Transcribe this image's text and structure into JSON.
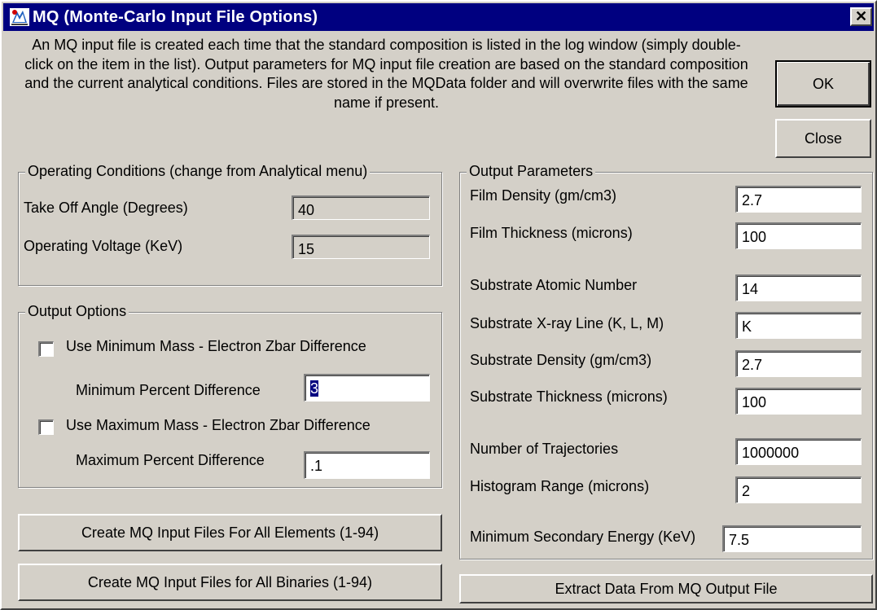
{
  "title": "MQ (Monte-Carlo Input File Options)",
  "close_glyph": "✕",
  "description": "An MQ input file is created each time that the standard composition is listed in the log window (simply double-click on the item in the list). Output parameters for MQ input file creation are based on the standard composition and the current analytical conditions. Files are stored in the MQData folder and will overwrite files with the same name if present.",
  "buttons": {
    "ok": "OK",
    "close": "Close",
    "create_all_elements": "Create MQ Input Files For All Elements (1-94)",
    "create_all_binaries": "Create MQ Input Files for All Binaries (1-94)",
    "extract_data": "Extract  Data From MQ Output File"
  },
  "operating_conditions": {
    "legend": "Operating Conditions (change from Analytical menu)",
    "take_off_label": "Take Off Angle (Degrees)",
    "take_off_value": "40",
    "voltage_label": "Operating Voltage (KeV)",
    "voltage_value": "15"
  },
  "output_options": {
    "legend": "Output Options",
    "use_min_label": "Use Minimum Mass - Electron Zbar Difference",
    "use_min_checked": false,
    "min_pct_label": "Minimum Percent Difference",
    "min_pct_value": "3",
    "use_max_label": "Use Maximum Mass - Electron Zbar Difference",
    "use_max_checked": false,
    "max_pct_label": "Maximum Percent Difference",
    "max_pct_value": ".1"
  },
  "output_parameters": {
    "legend": "Output Parameters",
    "film_density_label": "Film Density (gm/cm3)",
    "film_density_value": "2.7",
    "film_thickness_label": "Film Thickness (microns)",
    "film_thickness_value": "100",
    "substrate_z_label": "Substrate Atomic Number",
    "substrate_z_value": "14",
    "substrate_line_label": "Substrate X-ray Line (K, L, M)",
    "substrate_line_value": "K",
    "substrate_density_label": "Substrate Density (gm/cm3)",
    "substrate_density_value": "2.7",
    "substrate_thickness_label": "Substrate Thickness (microns)",
    "substrate_thickness_value": "100",
    "trajectories_label": "Number of Trajectories",
    "trajectories_value": "1000000",
    "histogram_label": "Histogram Range (microns)",
    "histogram_value": "2",
    "min_secondary_label": "Minimum Secondary Energy (KeV)",
    "min_secondary_value": "7.5"
  },
  "colors": {
    "titlebar": "#000080",
    "face": "#d4d0c8",
    "selection": "#000080"
  }
}
